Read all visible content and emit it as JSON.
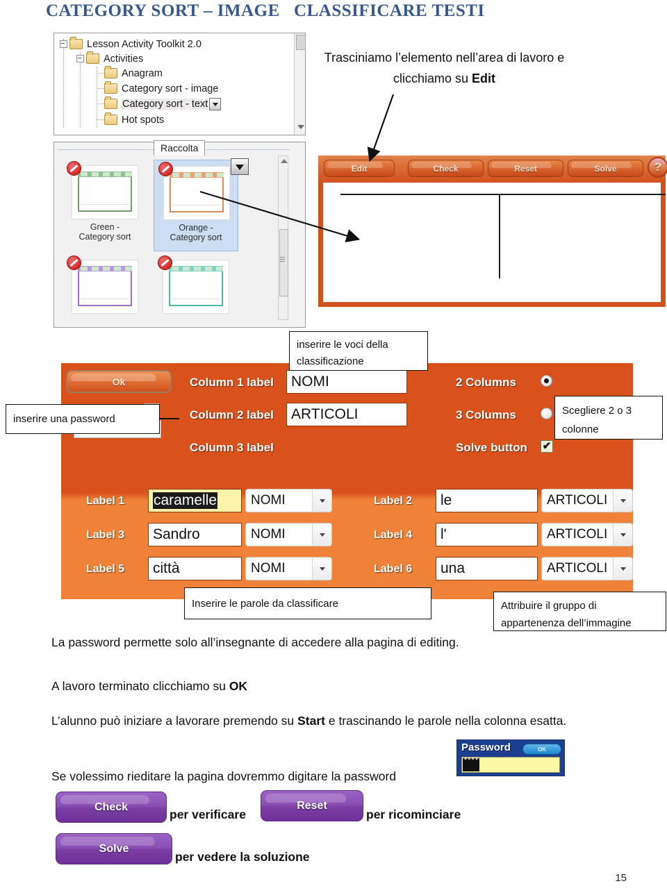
{
  "page": {
    "title": "CATEGORY SORT – IMAGE   CLASSIFICARE TESTI",
    "number": "15"
  },
  "tree_panel": {
    "nodes": [
      {
        "label": "Lesson Activity Toolkit 2.0",
        "depth": 0,
        "expandable": true
      },
      {
        "label": "Activities",
        "depth": 1,
        "expandable": true
      },
      {
        "label": "Anagram",
        "depth": 2,
        "expandable": false
      },
      {
        "label": "Category sort - image",
        "depth": 2,
        "expandable": false
      },
      {
        "label": "Category sort - text",
        "depth": 2,
        "expandable": false,
        "selected": true,
        "has_dropdown": true
      },
      {
        "label": "Hot spots",
        "depth": 2,
        "expandable": false
      }
    ]
  },
  "gallery_panel": {
    "tab_label": "Raccolta",
    "thumbnails": [
      {
        "label": "Green -\nCategory sort",
        "color": "#6f9f6f",
        "bar": "#8fbf8f",
        "selected": false
      },
      {
        "label": "Orange -\nCategory sort",
        "color": "#d98a5a",
        "bar": "#e8a173",
        "selected": true
      },
      {
        "label": "",
        "color": "#9b72c4",
        "bar": "#b79bd8",
        "selected": false
      },
      {
        "label": "",
        "color": "#4fb8ae",
        "bar": "#7fd3cb",
        "selected": false
      }
    ]
  },
  "activity_widget": {
    "buttons": [
      {
        "label": "Edit"
      },
      {
        "label": "Check"
      },
      {
        "label": "Reset"
      },
      {
        "label": "Solve"
      }
    ],
    "help_label": "?"
  },
  "editor": {
    "ok_label": "Ok",
    "column_labels": [
      {
        "label": "Column 1 label",
        "value": "NOMI"
      },
      {
        "label": "Column 2 label",
        "value": "ARTICOLI"
      },
      {
        "label": "Column 3 label",
        "value": ""
      }
    ],
    "options": [
      {
        "label": "2 Columns",
        "type": "radio",
        "checked": true
      },
      {
        "label": "3 Columns",
        "type": "radio",
        "checked": false
      },
      {
        "label": "Solve button",
        "type": "checkbox",
        "checked": true,
        "mark": "✔"
      }
    ],
    "rows": [
      {
        "label": "Label 1",
        "value": "caramelle",
        "group": "NOMI",
        "highlighted": true
      },
      {
        "label": "Label 2",
        "value": "le",
        "group": "ARTICOLI",
        "highlighted": false
      },
      {
        "label": "Label 3",
        "value": "Sandro",
        "group": "NOMI",
        "highlighted": false
      },
      {
        "label": "Label 4",
        "value": "l'",
        "group": "ARTICOLI",
        "highlighted": false
      },
      {
        "label": "Label 5",
        "value": "città",
        "group": "NOMI",
        "highlighted": false
      },
      {
        "label": "Label 6",
        "value": "una",
        "group": "ARTICOLI",
        "highlighted": false
      }
    ]
  },
  "callouts": {
    "drag_instruction_line1": "Trasciniamo l’elemento nell’area di lavoro e",
    "drag_instruction_line2_prefix": "clicchiamo su ",
    "drag_instruction_line2_bold": "Edit",
    "insert_items": "inserire le voci della classificazione",
    "insert_password": "inserire una password",
    "choose_columns": "Scegliere 2 o 3 colonne",
    "insert_words": "Inserire le parole da classificare",
    "assign_group": "Attribuire il gruppo di appartenenza dell’immagine"
  },
  "body_text": {
    "p1": "La password permette solo all’insegnante di accedere alla pagina di editing.",
    "p2_prefix": "A lavoro terminato clicchiamo su ",
    "p2_bold": "OK",
    "p3_prefix": "L’alunno può iniziare a lavorare premendo su ",
    "p3_bold": "Start",
    "p3_suffix": " e trascinando le parole nella colonna esatta.",
    "p4": "Se volessimo rieditare la pagina dovremmo digitare la password"
  },
  "password_widget": {
    "title": "Password",
    "ok_label": "OK",
    "value_mask": "****"
  },
  "action_buttons": [
    {
      "label": "Check",
      "caption": "per verificare"
    },
    {
      "label": "Reset",
      "caption": "per ricominciare"
    },
    {
      "label": "Solve",
      "caption": "per vedere la soluzione"
    }
  ],
  "colors": {
    "title_blue": "#36588f",
    "orange_dark": "#d2521e",
    "orange_light": "#ef8238",
    "purple": "#7a3ea3",
    "password_blue": "#1d3f8f"
  }
}
